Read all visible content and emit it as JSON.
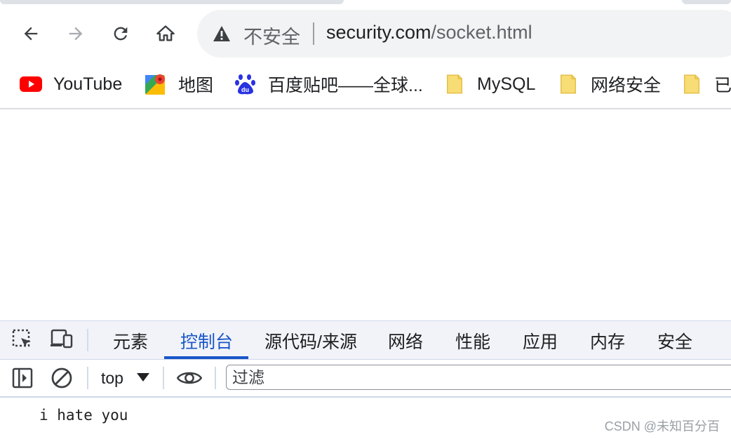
{
  "toolbar": {
    "security_label": "不安全",
    "url_host": "security.com",
    "url_path": "/socket.html"
  },
  "bookmarks": [
    {
      "label": "YouTube",
      "icon": "youtube-icon"
    },
    {
      "label": "地图",
      "icon": "maps-icon"
    },
    {
      "label": "百度贴吧——全球...",
      "icon": "baidu-icon"
    },
    {
      "label": "MySQL",
      "icon": "folder-icon"
    },
    {
      "label": "网络安全",
      "icon": "folder-icon"
    },
    {
      "label": "已",
      "icon": "folder-icon"
    }
  ],
  "devtools": {
    "tabs": [
      {
        "label": "元素"
      },
      {
        "label": "控制台",
        "active": true
      },
      {
        "label": "源代码/来源"
      },
      {
        "label": "网络"
      },
      {
        "label": "性能"
      },
      {
        "label": "应用"
      },
      {
        "label": "内存"
      },
      {
        "label": "安全"
      }
    ],
    "context": "top",
    "filter_placeholder": "过滤"
  },
  "console": {
    "lines": [
      "i hate you"
    ]
  },
  "watermark": "CSDN @未知百分百",
  "colors": {
    "accent": "#1a56c8",
    "youtube_red": "#ff0000",
    "folder_yellow": "#f8dc75",
    "baidu_blue": "#2932e1"
  }
}
